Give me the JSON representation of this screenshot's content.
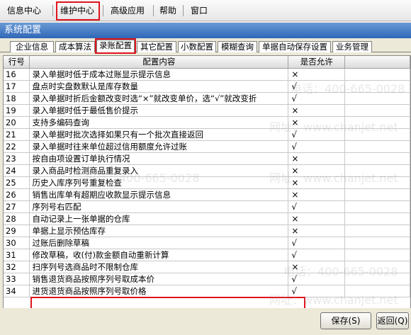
{
  "menu": {
    "items": [
      {
        "name": "menu-info-center",
        "label": "信息中心"
      },
      {
        "name": "menu-maintenance-center",
        "label": "维护中心"
      },
      {
        "name": "menu-advanced",
        "label": "高级应用"
      },
      {
        "name": "menu-help",
        "label": "帮助"
      },
      {
        "name": "menu-window",
        "label": "窗口"
      }
    ]
  },
  "window": {
    "title": "系统配置"
  },
  "tabs": [
    {
      "label": "企业信息"
    },
    {
      "label": "成本算法"
    },
    {
      "label": "录账配置"
    },
    {
      "label": "其它配置"
    },
    {
      "label": "小数配置"
    },
    {
      "label": "模糊查询"
    },
    {
      "label": "单据自动保存设置"
    },
    {
      "label": "业务管理"
    }
  ],
  "active_tab": "录账配置",
  "table": {
    "columns": [
      "行号",
      "配置内容",
      "是否允许"
    ],
    "rows": [
      {
        "no": "16",
        "content": "录入单据时低于成本过账显示提示信息",
        "allowed": "×"
      },
      {
        "no": "17",
        "content": "盘点时实盘数默认是库存数量",
        "allowed": "√"
      },
      {
        "no": "18",
        "content": "录入单据时折后金额改变时选“×”就改变单价，选“√”就改变折",
        "allowed": "√"
      },
      {
        "no": "19",
        "content": "录入单据时低于最低售价提示",
        "allowed": "×"
      },
      {
        "no": "20",
        "content": "支持多编码查询",
        "allowed": "×"
      },
      {
        "no": "21",
        "content": "录入单据时批次选择如果只有一个批次直接返回",
        "allowed": "√"
      },
      {
        "no": "22",
        "content": "录入单据时往来单位超过信用额度允许过账",
        "allowed": "√"
      },
      {
        "no": "23",
        "content": "按自由项设置订单执行情况",
        "allowed": "×"
      },
      {
        "no": "24",
        "content": "录入商品时检测商品重复录入",
        "allowed": "×"
      },
      {
        "no": "25",
        "content": "历史入库序列号重复检查",
        "allowed": "×"
      },
      {
        "no": "26",
        "content": "销售出库单有超期应收款显示提示信息",
        "allowed": "×"
      },
      {
        "no": "27",
        "content": "序列号右匹配",
        "allowed": "√"
      },
      {
        "no": "28",
        "content": "自动记录上一张单据的仓库",
        "allowed": "×"
      },
      {
        "no": "29",
        "content": "单据上显示预估库存",
        "allowed": "×"
      },
      {
        "no": "30",
        "content": "过账后删除草稿",
        "allowed": "√"
      },
      {
        "no": "31",
        "content": "修改草稿，收(付)款金额自动重新计算",
        "allowed": "√"
      },
      {
        "no": "32",
        "content": "扫序列号选商品时不限制仓库",
        "allowed": "×"
      },
      {
        "no": "33",
        "content": "销售退货商品按照序列号取成本价",
        "allowed": "√"
      },
      {
        "no": "34",
        "content": "进货退货商品按照序列号取价格",
        "allowed": "√"
      }
    ]
  },
  "buttons": {
    "save": "保存(S)",
    "back": "返回(Q)"
  },
  "watermarks": [
    "电话：400-665-0028",
    "网址：www.chanjet.net",
    "电话：400-665-0028",
    "网址：www.chanjet.net",
    "电话：400-665-0028",
    "网址：www.chanjet.net",
    "电话：400-665-0028"
  ],
  "colors": {
    "highlight_box": "#e0141e",
    "titlebar": "#2f67b7"
  }
}
